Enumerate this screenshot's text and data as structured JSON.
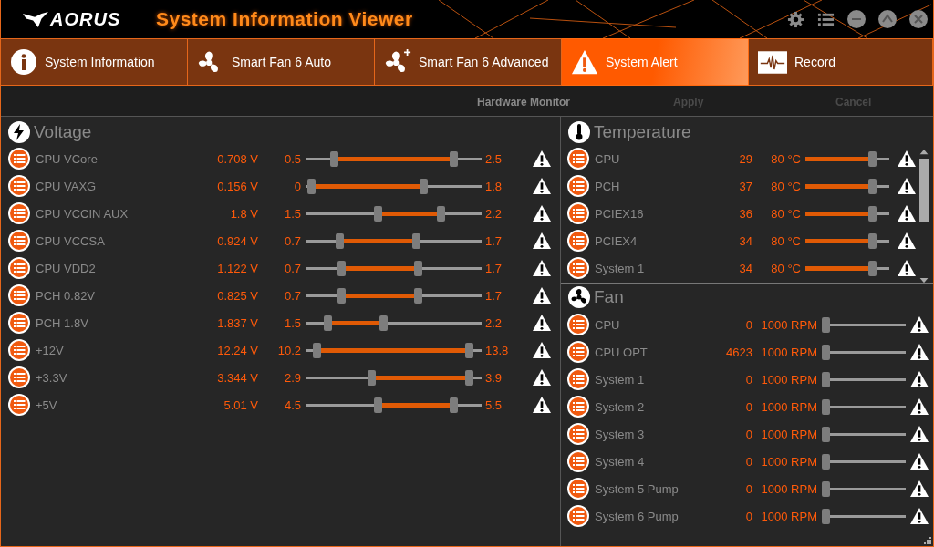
{
  "window": {
    "logo": "AORUS",
    "title": "System Information Viewer"
  },
  "tabs": [
    {
      "label": "System Information",
      "kind": "info",
      "selected": false
    },
    {
      "label": "Smart Fan 6 Auto",
      "kind": "fan",
      "selected": false
    },
    {
      "label": "Smart Fan 6 Advanced",
      "kind": "fanplus",
      "selected": false
    },
    {
      "label": "System Alert",
      "kind": "alert",
      "selected": true
    },
    {
      "label": "Record",
      "kind": "record",
      "selected": false
    }
  ],
  "toolbar": [
    {
      "label": "Hardware Monitor",
      "disabled": false
    },
    {
      "label": "Apply",
      "disabled": true
    },
    {
      "label": "Cancel",
      "disabled": true
    }
  ],
  "voltage": {
    "title": "Voltage",
    "rows": [
      {
        "name": "CPU VCore",
        "value": "0.708 V",
        "min": "0.5",
        "max": "2.5",
        "low_thumb": {
          "level": 0.16
        },
        "high_thumb": {
          "level": 0.84
        }
      },
      {
        "name": "CPU VAXG",
        "value": "0.156 V",
        "min": "0",
        "max": "1.8",
        "low_thumb": {
          "level": 0.03
        },
        "high_thumb": {
          "level": 0.67
        }
      },
      {
        "name": "CPU VCCIN AUX",
        "value": "1.8 V",
        "min": "1.5",
        "max": "2.2",
        "low_thumb": {
          "level": 0.41
        },
        "high_thumb": {
          "level": 0.77
        }
      },
      {
        "name": "CPU VCCSA",
        "value": "0.924 V",
        "min": "0.7",
        "max": "1.7",
        "low_thumb": {
          "level": 0.19
        },
        "high_thumb": {
          "level": 0.63
        }
      },
      {
        "name": "CPU VDD2",
        "value": "1.122 V",
        "min": "0.7",
        "max": "1.7",
        "low_thumb": {
          "level": 0.2
        },
        "high_thumb": {
          "level": 0.64
        }
      },
      {
        "name": "PCH 0.82V",
        "value": "0.825 V",
        "min": "0.7",
        "max": "1.7",
        "low_thumb": {
          "level": 0.2
        },
        "high_thumb": {
          "level": 0.64
        }
      },
      {
        "name": "PCH 1.8V",
        "value": "1.837 V",
        "min": "1.5",
        "max": "2.2",
        "low_thumb": {
          "level": 0.12
        },
        "high_thumb": {
          "level": 0.44
        }
      },
      {
        "name": "+12V",
        "value": "12.24 V",
        "min": "10.2",
        "max": "13.8",
        "low_thumb": {
          "level": 0.06
        },
        "high_thumb": {
          "level": 0.93
        }
      },
      {
        "name": "+3.3V",
        "value": "3.344 V",
        "min": "2.9",
        "max": "3.9",
        "low_thumb": {
          "level": 0.37
        },
        "high_thumb": {
          "level": 0.93
        }
      },
      {
        "name": "+5V",
        "value": "5.01 V",
        "min": "4.5",
        "max": "5.5",
        "low_thumb": {
          "level": 0.41
        },
        "high_thumb": {
          "level": 0.84
        }
      }
    ]
  },
  "temperature": {
    "title": "Temperature",
    "rows": [
      {
        "name": "CPU",
        "value": "29",
        "limit": "80 °C",
        "level": 0.8
      },
      {
        "name": "PCH",
        "value": "37",
        "limit": "80 °C",
        "level": 0.8
      },
      {
        "name": "PCIEX16",
        "value": "36",
        "limit": "80 °C",
        "level": 0.8
      },
      {
        "name": "PCIEX4",
        "value": "34",
        "limit": "80 °C",
        "level": 0.8
      },
      {
        "name": "System 1",
        "value": "34",
        "limit": "80 °C",
        "level": 0.8
      }
    ]
  },
  "fan": {
    "title": "Fan",
    "rows": [
      {
        "name": "CPU",
        "value": "0",
        "limit": "1000 RPM",
        "level": 0.05
      },
      {
        "name": "CPU OPT",
        "value": "4623",
        "limit": "1000 RPM",
        "level": 0.05
      },
      {
        "name": "System 1",
        "value": "0",
        "limit": "1000 RPM",
        "level": 0.05
      },
      {
        "name": "System 2",
        "value": "0",
        "limit": "1000 RPM",
        "level": 0.05
      },
      {
        "name": "System 3",
        "value": "0",
        "limit": "1000 RPM",
        "level": 0.05
      },
      {
        "name": "System 4",
        "value": "0",
        "limit": "1000 RPM",
        "level": 0.05
      },
      {
        "name": "System 5 Pump",
        "value": "0",
        "limit": "1000 RPM",
        "level": 0.05
      },
      {
        "name": "System 6 Pump",
        "value": "0",
        "limit": "1000 RPM",
        "level": 0.05
      }
    ]
  }
}
